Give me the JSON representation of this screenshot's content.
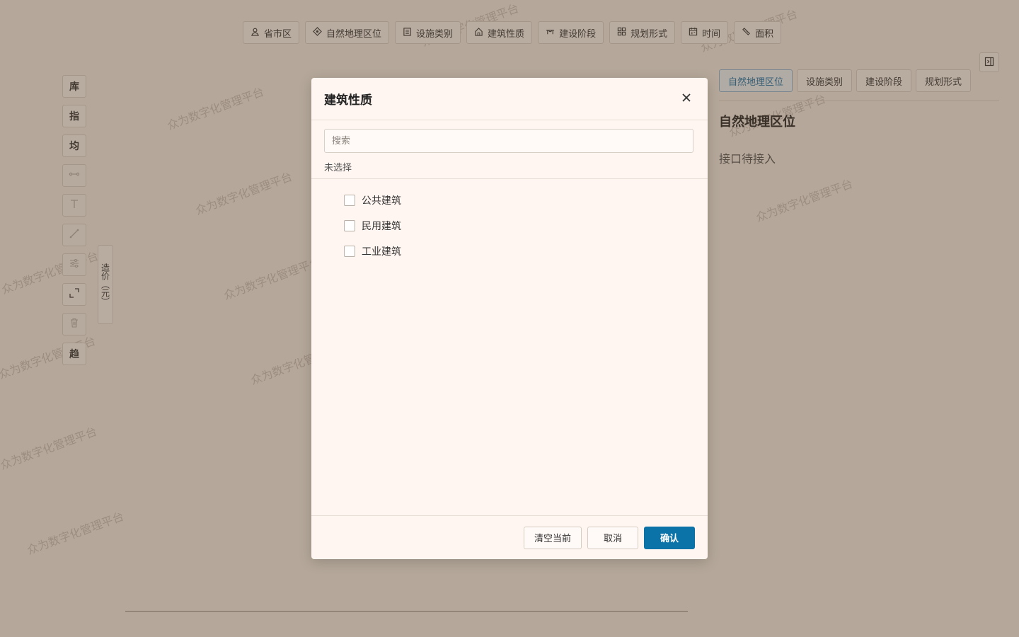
{
  "watermark_text": "众为数字化管理平台",
  "top_filters": [
    {
      "label": "省市区",
      "icon": "person-pin-icon"
    },
    {
      "label": "自然地理区位",
      "icon": "location-target-icon"
    },
    {
      "label": "设施类别",
      "icon": "building-icon"
    },
    {
      "label": "建筑性质",
      "icon": "home-icon"
    },
    {
      "label": "建设阶段",
      "icon": "bridge-icon"
    },
    {
      "label": "规划形式",
      "icon": "grid-icon"
    },
    {
      "label": "时间",
      "icon": "calendar-icon"
    },
    {
      "label": "面积",
      "icon": "ruler-icon"
    }
  ],
  "left_tools": {
    "library": "库",
    "index": "指",
    "average": "均",
    "trend": "趋"
  },
  "vertical_tab_label": "造价（元）",
  "right_panel": {
    "tabs": [
      "自然地理区位",
      "设施类别",
      "建设阶段",
      "规划形式"
    ],
    "title": "自然地理区位",
    "text": "接口待接入"
  },
  "dialog": {
    "title": "建筑性质",
    "search_placeholder": "搜索",
    "selection_status": "未选择",
    "options": [
      "公共建筑",
      "民用建筑",
      "工业建筑"
    ],
    "buttons": {
      "clear": "清空当前",
      "cancel": "取消",
      "confirm": "确认"
    }
  },
  "colors": {
    "primary": "#0b73a8",
    "active_tab_text": "#1a6fa5",
    "overlay": "rgba(90,70,50,0.42)"
  }
}
